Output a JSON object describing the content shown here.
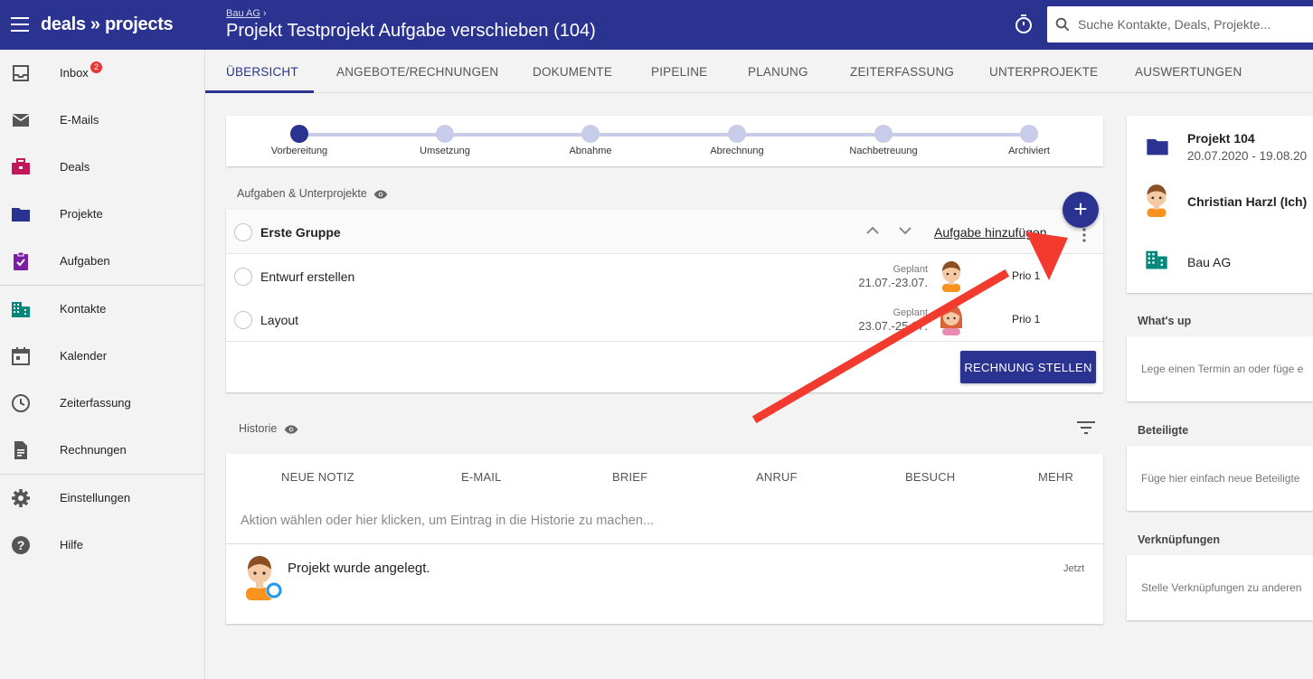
{
  "app": {
    "logo": "deals » projects"
  },
  "header": {
    "breadcrumb": "Bau AG",
    "breadcrumb_sep": "›",
    "title": "Projekt Testprojekt Aufgabe verschieben (104)",
    "search_placeholder": "Suche Kontakte, Deals, Projekte..."
  },
  "sidebar": {
    "items": [
      {
        "label": "Inbox",
        "badge": "2",
        "icon": "inbox-icon"
      },
      {
        "label": "E-Mails",
        "icon": "mail-icon"
      },
      {
        "label": "Deals",
        "icon": "briefcase-icon"
      },
      {
        "label": "Projekte",
        "icon": "folder-icon"
      },
      {
        "label": "Aufgaben",
        "icon": "clipboard-check-icon"
      },
      {
        "label": "Kontakte",
        "icon": "building-icon"
      },
      {
        "label": "Kalender",
        "icon": "calendar-icon"
      },
      {
        "label": "Zeiterfassung",
        "icon": "clock-icon"
      },
      {
        "label": "Rechnungen",
        "icon": "document-icon"
      },
      {
        "label": "Einstellungen",
        "icon": "gear-icon"
      },
      {
        "label": "Hilfe",
        "icon": "help-icon"
      }
    ],
    "colors": {
      "deals": "#c2185b",
      "projekte": "#2b3390",
      "aufgaben": "#7b1fa2",
      "kontakte": "#00897b",
      "default": "#555555"
    }
  },
  "tabs": [
    "ÜBERSICHT",
    "ANGEBOTE/RECHNUNGEN",
    "DOKUMENTE",
    "PIPELINE",
    "PLANUNG",
    "ZEITERFASSUNG",
    "UNTERPROJEKTE",
    "AUSWERTUNGEN"
  ],
  "stepper": {
    "steps": [
      "Vorbereitung",
      "Umsetzung",
      "Abnahme",
      "Abrechnung",
      "Nachbetreuung",
      "Archiviert"
    ],
    "active_index": 0
  },
  "tasks": {
    "section_title": "Aufgaben & Unterprojekte",
    "group_name": "Erste Gruppe",
    "add_link": "Aufgabe hinzufügen",
    "fab_label": "+",
    "items": [
      {
        "name": "Entwurf erstellen",
        "planned_label": "Geplant",
        "dates": "21.07.-23.07.",
        "prio": "Prio 1"
      },
      {
        "name": "Layout",
        "planned_label": "Geplant",
        "dates": "23.07.-25.07.",
        "prio": "Prio 1"
      }
    ],
    "invoice_button": "RECHNUNG STELLEN"
  },
  "history": {
    "section_title": "Historie",
    "tabs": [
      "NEUE NOTIZ",
      "E-MAIL",
      "BRIEF",
      "ANRUF",
      "BESUCH",
      "MEHR"
    ],
    "placeholder": "Aktion wählen oder hier klicken, um Eintrag in die Historie zu machen...",
    "entry_text": "Projekt wurde angelegt.",
    "entry_time": "Jetzt"
  },
  "right": {
    "project_name": "Projekt 104",
    "project_dates": "20.07.2020 - 19.08.20",
    "owner": "Christian Harzl (Ich)",
    "company": "Bau AG",
    "whatsup_title": "What's up",
    "whatsup_hint": "Lege einen Termin an oder füge e",
    "beteiligte_title": "Beteiligte",
    "beteiligte_hint": "Füge hier einfach neue Beteiligte",
    "verknuepfungen_title": "Verknüpfungen",
    "verknuepfungen_hint": "Stelle Verknüpfungen zu anderen"
  },
  "colors": {
    "primary": "#2b3390",
    "annotation_arrow": "#f23a2e",
    "badge": "#e53935"
  }
}
